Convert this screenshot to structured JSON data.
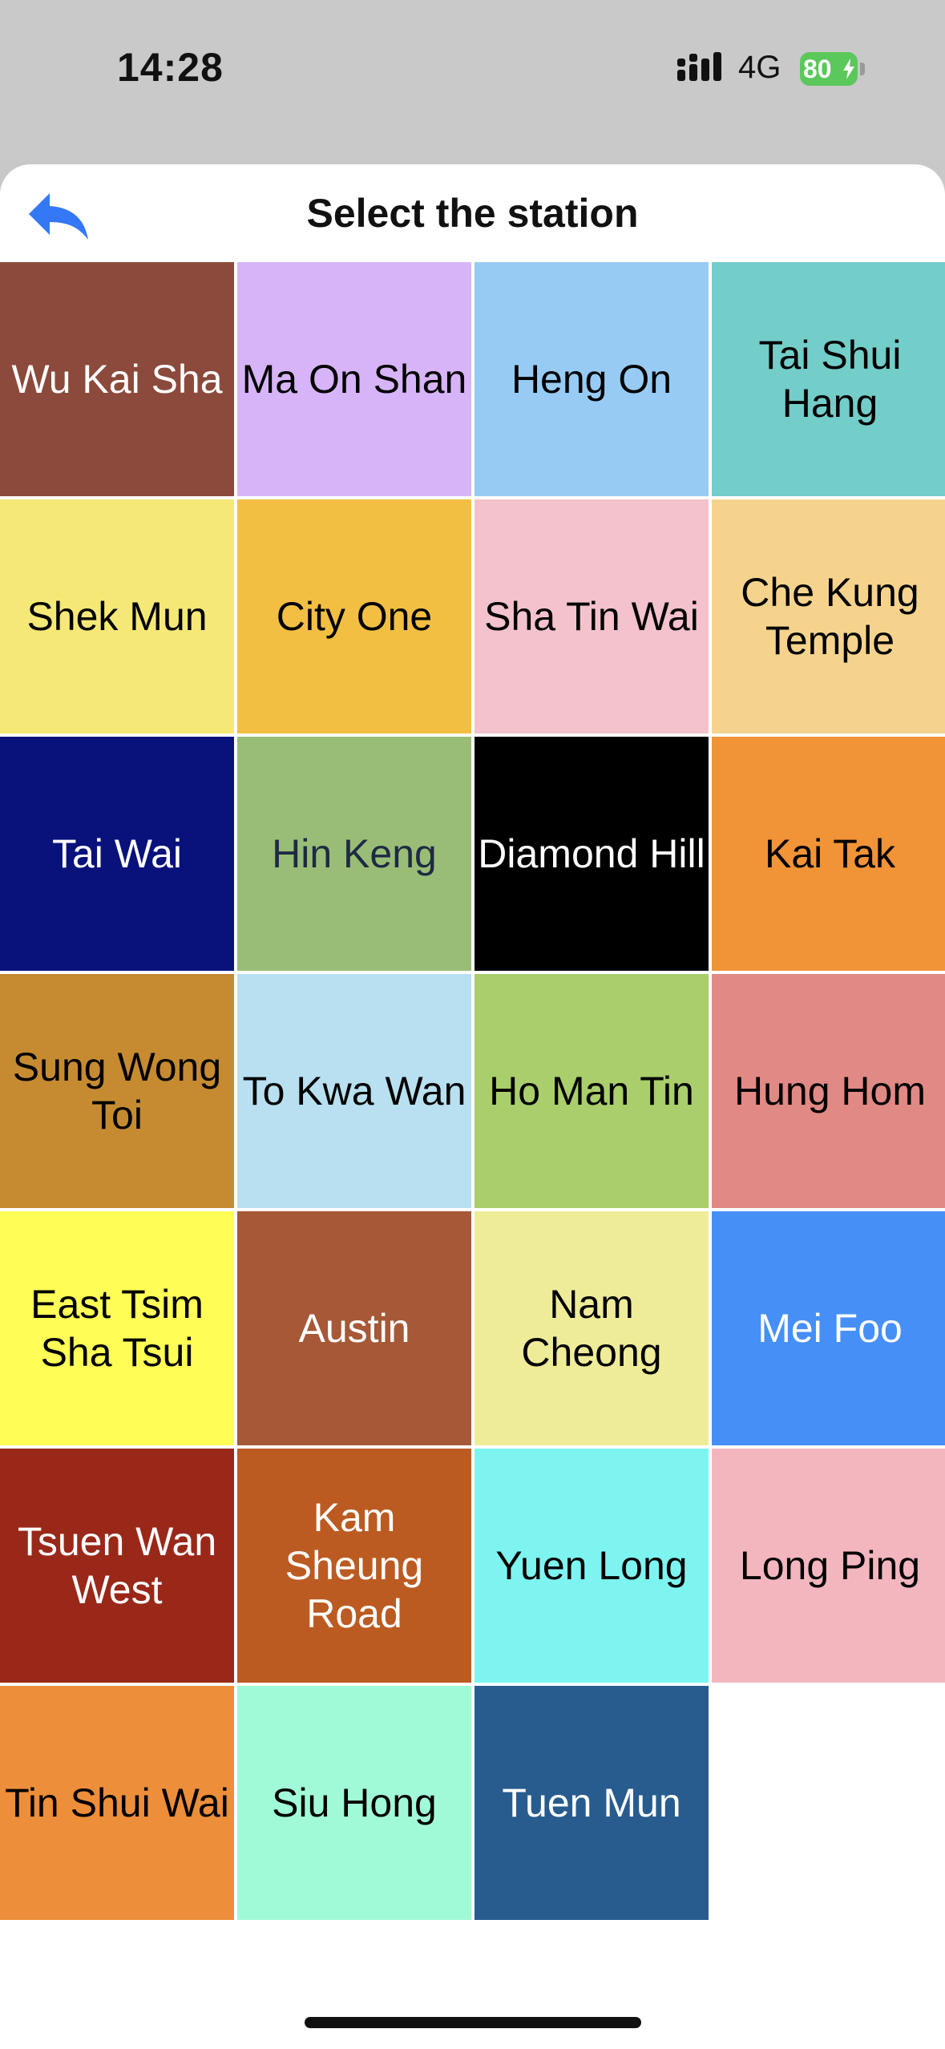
{
  "status_bar": {
    "time": "14:28",
    "network": "4G",
    "battery": "80"
  },
  "header": {
    "title": "Select the station",
    "back_icon": "back-arrow-icon",
    "accent": "#3478f6"
  },
  "stations": [
    {
      "name": "Wu Kai Sha",
      "bg": "#8b4a3b",
      "fg": "#ffffff"
    },
    {
      "name": "Ma On Shan",
      "bg": "#d7b4f8",
      "fg": "#000000"
    },
    {
      "name": "Heng On",
      "bg": "#97cbf3",
      "fg": "#000000"
    },
    {
      "name": "Tai Shui Hang",
      "bg": "#73cdc9",
      "fg": "#000000"
    },
    {
      "name": "Shek Mun",
      "bg": "#f5e876",
      "fg": "#000000"
    },
    {
      "name": "City One",
      "bg": "#f2bf42",
      "fg": "#000000"
    },
    {
      "name": "Sha Tin Wai",
      "bg": "#f3c2cc",
      "fg": "#000000"
    },
    {
      "name": "Che Kung Temple",
      "bg": "#f6d38d",
      "fg": "#000000"
    },
    {
      "name": "Tai Wai",
      "bg": "#08127a",
      "fg": "#ffffff"
    },
    {
      "name": "Hin Keng",
      "bg": "#99bd76",
      "fg": "#1e2a44"
    },
    {
      "name": "Diamond Hill",
      "bg": "#000000",
      "fg": "#ffffff"
    },
    {
      "name": "Kai Tak",
      "bg": "#f19337",
      "fg": "#000000"
    },
    {
      "name": "Sung Wong Toi",
      "bg": "#c68b31",
      "fg": "#000000"
    },
    {
      "name": "To Kwa Wan",
      "bg": "#b8e0f0",
      "fg": "#000000"
    },
    {
      "name": "Ho Man Tin",
      "bg": "#a9ce6b",
      "fg": "#000000"
    },
    {
      "name": "Hung Hom",
      "bg": "#e18985",
      "fg": "#000000"
    },
    {
      "name": "East Tsim Sha Tsui",
      "bg": "#fffd56",
      "fg": "#000000"
    },
    {
      "name": "Austin",
      "bg": "#a65837",
      "fg": "#ffffff"
    },
    {
      "name": "Nam Cheong",
      "bg": "#efec99",
      "fg": "#000000"
    },
    {
      "name": "Mei Foo",
      "bg": "#468ff7",
      "fg": "#ffffff"
    },
    {
      "name": "Tsuen Wan West",
      "bg": "#992819",
      "fg": "#ffffff"
    },
    {
      "name": "Kam Sheung Road",
      "bg": "#bb5b22",
      "fg": "#ffffff"
    },
    {
      "name": "Yuen Long",
      "bg": "#7ef4f1",
      "fg": "#000000"
    },
    {
      "name": "Long Ping",
      "bg": "#f3b6bf",
      "fg": "#000000"
    },
    {
      "name": "Tin Shui Wai",
      "bg": "#ec8e3a",
      "fg": "#000000"
    },
    {
      "name": "Siu Hong",
      "bg": "#a1fad7",
      "fg": "#000000"
    },
    {
      "name": "Tuen Mun",
      "bg": "#285c8e",
      "fg": "#ffffff"
    }
  ]
}
